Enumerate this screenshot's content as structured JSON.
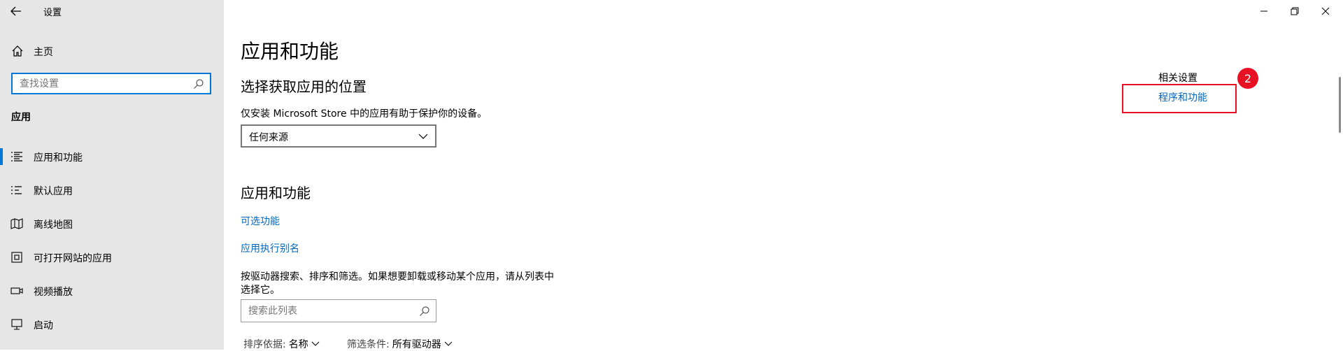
{
  "window": {
    "title": "设置",
    "controls": [
      {
        "icon": "minimize-icon"
      },
      {
        "icon": "restore-icon"
      },
      {
        "icon": "close-icon"
      }
    ]
  },
  "sidebar": {
    "home_label": "主页",
    "search_placeholder": "查找设置",
    "section_label": "应用",
    "items": [
      {
        "label": "应用和功能",
        "icon": "apps-features-icon",
        "selected": true
      },
      {
        "label": "默认应用",
        "icon": "default-apps-icon",
        "selected": false
      },
      {
        "label": "离线地图",
        "icon": "offline-maps-icon",
        "selected": false
      },
      {
        "label": "可打开网站的应用",
        "icon": "apps-for-websites-icon",
        "selected": false
      },
      {
        "label": "视频播放",
        "icon": "video-playback-icon",
        "selected": false
      },
      {
        "label": "启动",
        "icon": "startup-icon",
        "selected": false
      }
    ]
  },
  "main": {
    "page_title": "应用和功能",
    "install_section": {
      "heading": "选择获取应用的位置",
      "description": "仅安装 Microsoft Store 中的应用有助于保护你的设备。",
      "dropdown_value": "任何来源"
    },
    "apps_section": {
      "heading": "应用和功能",
      "optional_features_link": "可选功能",
      "app_alias_link": "应用执行别名",
      "instructions_line1": "按驱动器搜索、排序和筛选。如果想要卸载或移动某个应用，请从列表中",
      "instructions_line2": "选择它。",
      "search_placeholder": "搜索此列表",
      "sort_label": "排序依据:",
      "sort_value": "名称",
      "filter_label": "筛选条件:",
      "filter_value": "所有驱动器"
    }
  },
  "related": {
    "title": "相关设置",
    "link": "程序和功能",
    "annotation_number": "2"
  },
  "colors": {
    "accent": "#0078d7",
    "link": "#0067c0",
    "sidebar_bg": "#e6e6e6",
    "annotation": "#e81123"
  }
}
